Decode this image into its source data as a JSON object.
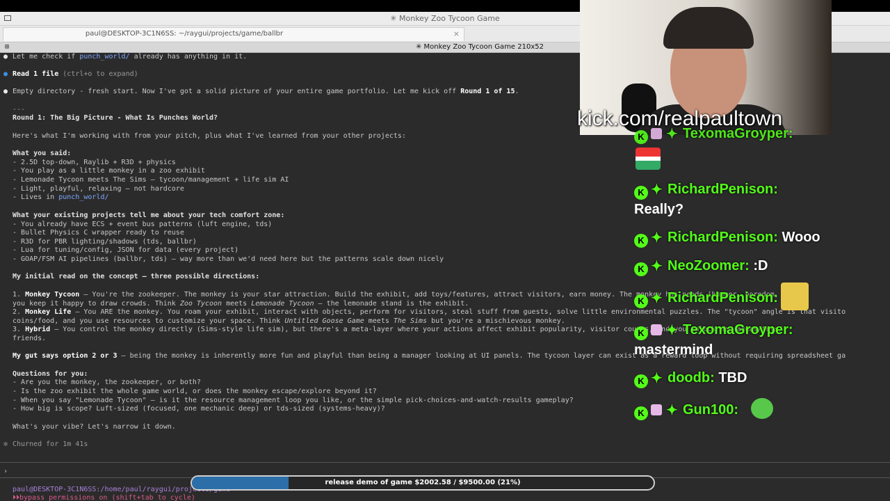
{
  "window": {
    "title": "✳ Monkey Zoo Tycoon Game",
    "tab_title": "paul@DESKTOP-3C1N6SS: ~/raygui/projects/game/ballbr",
    "tab_close": "×",
    "pane_title": "✳ Monkey Zoo Tycoon Game 210x52"
  },
  "terminal": {
    "l1_pre": "Let me check if ",
    "l1_hl": "punch_world/",
    "l1_post": " already has anything in it.",
    "l2_bold": "Read 1 file",
    "l2_rest": " (ctrl+o to expand)",
    "l3_pre": "Empty directory - fresh start. Now I've got a solid picture of your entire game portfolio. Let me kick off ",
    "l3_hl": "Round 1 of 15",
    "l3_post": ".",
    "rule": "---",
    "round_title": "Round 1: The Big Picture - What Is Punches World?",
    "intro": "Here's what I'm working with from your pitch, plus what I've learned from your other projects:",
    "said_header": "What you said:",
    "said": [
      "- 2.5D top-down, Raylib + R3D + physics",
      "- You play as a little monkey in a zoo exhibit",
      "- Lemonade Tycoon meets The Sims — tycoon/management + life sim AI",
      "- Light, playful, relaxing — not hardcore"
    ],
    "lives_pre": "- Lives in ",
    "lives_hl": "punch_world/",
    "existing_header": "What your existing projects tell me about your tech comfort zone:",
    "existing": [
      "- You already have ECS + event bus patterns (luft engine, tds)",
      "- Bullet Physics C wrapper ready to reuse",
      "- R3D for PBR lighting/shadows (tds, ballbr)",
      "- Lua for tuning/config, JSON for data (every project)",
      "- GOAP/FSM AI pipelines (ballbr, tds) — way more than we'd need here but the patterns scale down nicely"
    ],
    "initial_header": "My initial read on the concept — three possible directions:",
    "opt1_num": "1. ",
    "opt1_name": "Monkey Tycoon",
    "opt1_a": " — You're the zookeeper. The monkey is your star attraction. Build the exhibit, add toys/features, attract visitors, earn money. The monkey has needs (hunger, boredom, soci",
    "opt1_b_pre": "you keep it happy to draw crowds. Think ",
    "opt1_b_i1": "Zoo Tycoon",
    "opt1_b_mid": " meets ",
    "opt1_b_i2": "Lemonade Tycoon",
    "opt1_b_post": " — the lemonade stand is the exhibit.",
    "opt2_num": "2. ",
    "opt2_name": "Monkey Life",
    "opt2_a": " — You ARE the monkey. You roam your exhibit, interact with objects, perform for visitors, steal stuff from guests, solve little environmental puzzles. The \"tycoon\" angle is that visito",
    "opt2_b_pre": "coins/food, and you use resources to customize your space. Think ",
    "opt2_b_i1": "Untitled Goose Game",
    "opt2_b_mid": " meets ",
    "opt2_b_i2": "The Sims",
    "opt2_b_post": " but you're a mischievous monkey.",
    "opt3_num": "3. ",
    "opt3_name": "Hybrid",
    "opt3_a": " — You control the monkey directly (Sims-style life sim), but there's a meta-layer where your actions affect exhibit popularity, visitor counts, and you unlock new areas/toys/",
    "opt3_b": "friends.",
    "gut_bold": "My gut says option 2 or 3",
    "gut_rest": " — being the monkey is inherently more fun and playful than being a manager looking at UI panels. The tycoon layer can exist as a reward loop without requiring spreadsheet ga",
    "questions_header": "Questions for you:",
    "questions": [
      "- Are you the monkey, the zookeeper, or both?",
      "- Is the zoo exhibit the whole game world, or does the monkey escape/explore beyond it?",
      "- When you say \"Lemonade Tycoon\" — is it the resource management loop you like, or the simple pick-choices-and-watch-results gameplay?",
      "- How big is scope? Luft-sized (focused, one mechanic deep) or tds-sized (systems-heavy)?"
    ],
    "vibe": "What's your vibe? Let's narrow it down.",
    "churned": "Churned for 1m 41s",
    "prompt_char": "›",
    "path_line": "paul@DESKTOP-3C1N6SS:/home/paul/raygui/projects/game",
    "perm_line": "⏵⏵bypass permissions on (shift+tab to cycle)"
  },
  "progress": {
    "label": "release demo of game $2002.58 / $9500.00 (21%)",
    "fraction": 0.21
  },
  "stream": {
    "url": "kick.com/realpaultown"
  },
  "chat": {
    "partial_user": "TexomaGroyper:",
    "messages": [
      {
        "user": "RichardPenison:",
        "text": ""
      },
      {
        "continuation": "Really?"
      },
      {
        "user": "RichardPenison:",
        "text": "Wooo"
      },
      {
        "user": "NeoZoomer:",
        "text": ":D"
      },
      {
        "user": "RichardPenison:",
        "text": ""
      },
      {
        "user": "TexomaGroyper:",
        "text": ""
      },
      {
        "continuation": "mastermind"
      },
      {
        "user": "doodb:",
        "text": "TBD"
      },
      {
        "user": "Gun100:",
        "text": ""
      }
    ],
    "emote_big_club": "BIG CLUB"
  },
  "colors": {
    "kick_green": "#53fc18",
    "terminal_bg": "#2b2b2b",
    "progress_fill": "#2b6ea8"
  }
}
